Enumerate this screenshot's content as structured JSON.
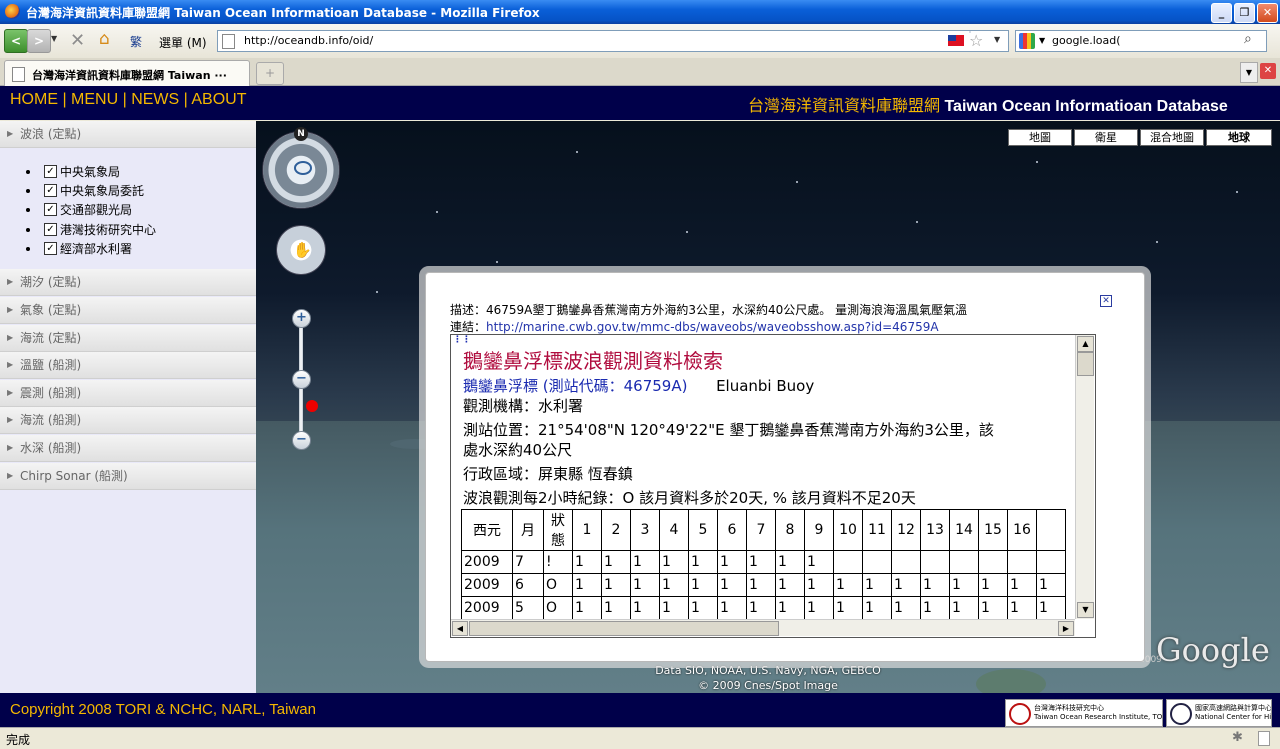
{
  "window": {
    "title": "台灣海洋資訊資料庫聯盟網 Taiwan Ocean Informatioan Database - Mozilla Firefox",
    "minimize": "_",
    "maximize": "❐",
    "close": "✕"
  },
  "toolbar": {
    "back": "<",
    "forward": ">",
    "lang": "繁",
    "menu": "選單 (M)",
    "url": "http://oceandb.info/oid/",
    "search_value": "google.load("
  },
  "tabs": [
    {
      "label": "台灣海洋資訊資料庫聯盟網 Taiwan ···"
    }
  ],
  "tab_new": "+",
  "site": {
    "nav": [
      "HOME",
      "MENU",
      "NEWS",
      "ABOUT"
    ],
    "separator": " | ",
    "title_cn": "台灣海洋資訊資料庫聯盟網 ",
    "title_en": "Taiwan Ocean Informatioan Database"
  },
  "sidebar": {
    "sections": [
      {
        "label": "波浪 (定點)",
        "expanded": true
      },
      {
        "label": "潮汐 (定點)"
      },
      {
        "label": "氣象 (定點)"
      },
      {
        "label": "海流 (定點)"
      },
      {
        "label": "溫鹽 (船測)"
      },
      {
        "label": "震測 (船測)"
      },
      {
        "label": "海流 (船測)"
      },
      {
        "label": "水深 (船測)"
      },
      {
        "label": "Chirp Sonar (船測)"
      }
    ],
    "wave_sources": [
      {
        "label": "中央氣象局",
        "checked": true
      },
      {
        "label": "中央氣象局委託",
        "checked": true
      },
      {
        "label": "交通部觀光局",
        "checked": true
      },
      {
        "label": "港灣技術研究中心",
        "checked": true
      },
      {
        "label": "經濟部水利署",
        "checked": true
      }
    ]
  },
  "map": {
    "types": [
      "地圖",
      "衛星",
      "混合地圖",
      "地球"
    ],
    "active_type": "地球",
    "north": "N",
    "zoom_in": "+",
    "zoom_out": "−",
    "credits_line1": "Data SIO, NOAA, U.S. Navy, NGA, GEBCO",
    "credits_line2": "© 2009 Cnes/Spot Image",
    "logo": "Google",
    "logo_year": "©2009"
  },
  "popup": {
    "close": "✕",
    "description": "描述：46759A墾丁鵝鑾鼻香蕉灣南方外海約3公里，水深約40公尺處。 量測海浪海溫風氣壓氣溫",
    "link_label": "連結：",
    "link_url": "http://marine.cwb.gov.tw/mmc-dbs/waveobs/waveobsshow.asp?id=46759A",
    "frame": {
      "title": "鵝鑾鼻浮標波浪觀測資料檢索",
      "station": "鵝鑾鼻浮標 (測站代碼：46759A)",
      "station_en": "Eluanbi Buoy",
      "agency": "觀測機構：水利署",
      "location_1": "測站位置：21°54'08\"N  120°49'22\"E     墾丁鵝鑾鼻香蕉灣南方外海約3公里，該",
      "location_2": "處水深約40公尺",
      "district": "行政區域：屏東縣  恆春鎮",
      "note": "波浪觀測每2小時紀錄：O 該月資料多於20天, % 該月資料不足20天",
      "table": {
        "headers": [
          "西元",
          "月",
          "狀態",
          "1",
          "2",
          "3",
          "4",
          "5",
          "6",
          "7",
          "8",
          "9",
          "10",
          "11",
          "12",
          "13",
          "14",
          "15",
          "16",
          ""
        ],
        "rows": [
          [
            "2009",
            "7",
            "!",
            "1",
            "1",
            "1",
            "1",
            "1",
            "1",
            "1",
            "1",
            "1",
            "",
            "",
            "",
            "",
            "",
            "",
            "",
            ""
          ],
          [
            "2009",
            "6",
            "O",
            "1",
            "1",
            "1",
            "1",
            "1",
            "1",
            "1",
            "1",
            "1",
            "1",
            "1",
            "1",
            "1",
            "1",
            "1",
            "1",
            "1"
          ],
          [
            "2009",
            "5",
            "O",
            "1",
            "1",
            "1",
            "1",
            "1",
            "1",
            "1",
            "1",
            "1",
            "1",
            "1",
            "1",
            "1",
            "1",
            "1",
            "1",
            "1"
          ]
        ]
      }
    }
  },
  "footer": {
    "copyright": "Copyright 2008 TORI & NCHC, NARL, Taiwan",
    "logo1_cn": "台灣海洋科技研究中心",
    "logo1_en": "Taiwan Ocean Research Institute, TORI",
    "logo2_cn": "國家高速網路與計算中心",
    "logo2_en": "National Center for High-performance Computing"
  },
  "status": "完成"
}
